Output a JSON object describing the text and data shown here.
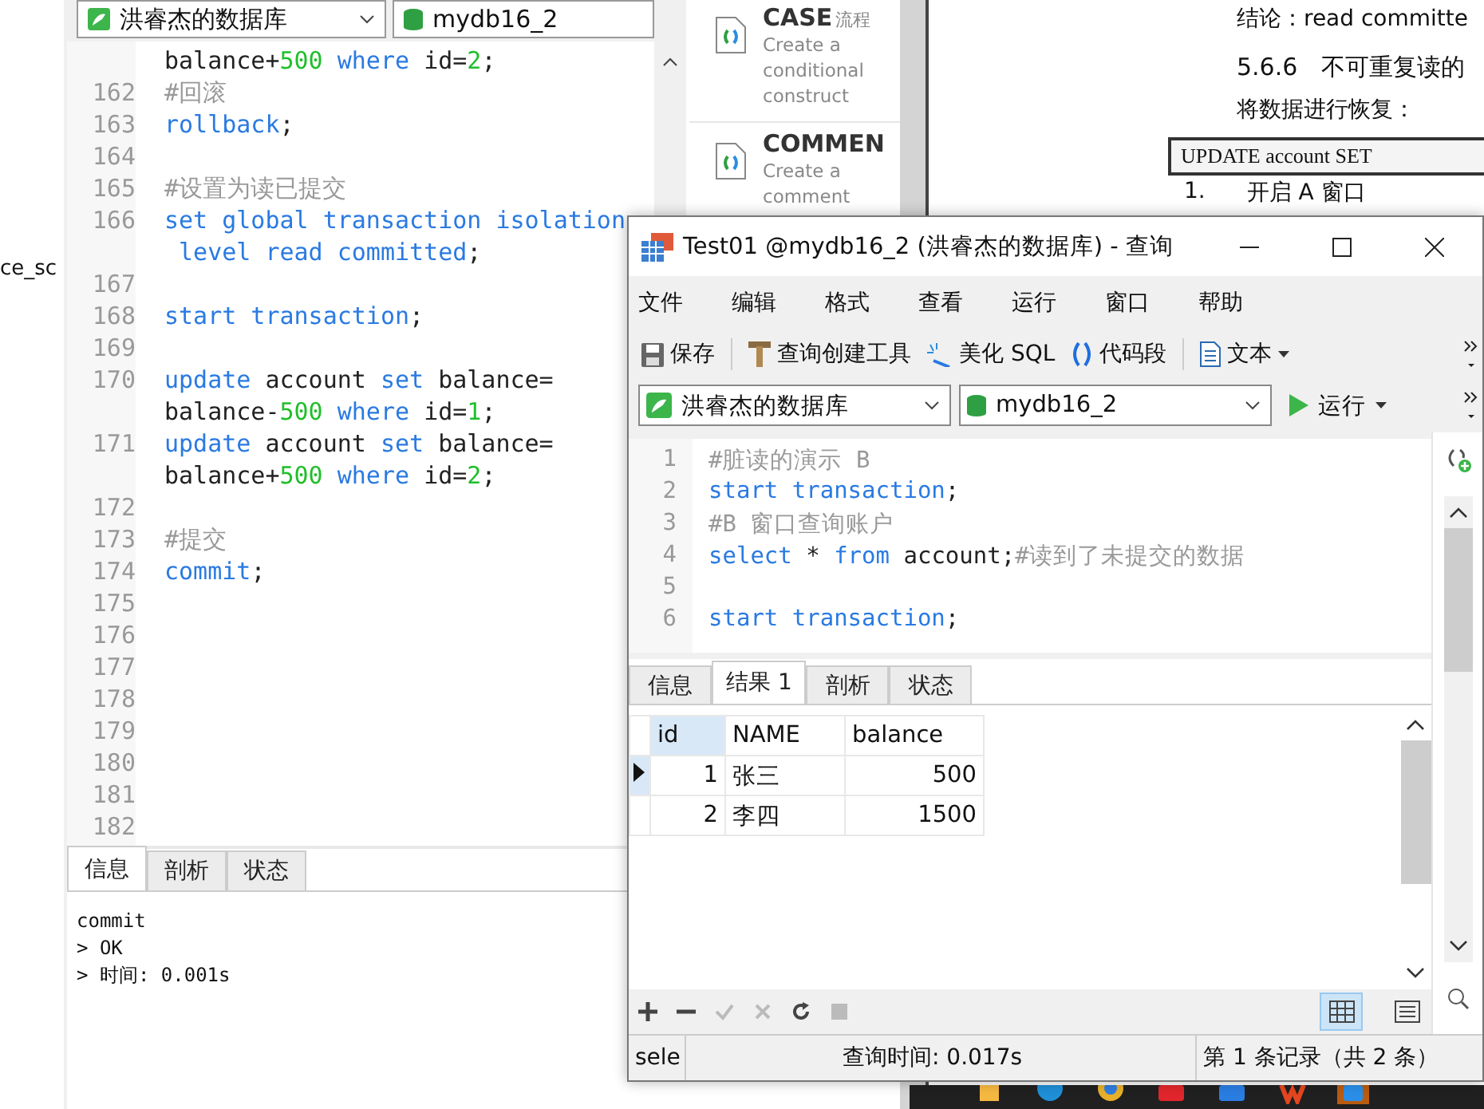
{
  "left_editor": {
    "connection": "洪睿杰的数据库",
    "database": "mydb16_2",
    "side_text": "ce_sc",
    "lines": [
      {
        "tokens": [
          {
            "kind": "plain",
            "text": "balance+"
          },
          {
            "kind": "num",
            "text": "500"
          },
          {
            "kind": "kw",
            "text": " where "
          },
          {
            "kind": "plain",
            "text": "id="
          },
          {
            "kind": "num",
            "text": "2"
          },
          {
            "kind": "plain",
            "text": ";"
          }
        ]
      },
      {
        "number": "162",
        "tokens": [
          {
            "kind": "comment",
            "text": "#回滚"
          }
        ]
      },
      {
        "number": "163",
        "tokens": [
          {
            "kind": "kw",
            "text": "rollback"
          },
          {
            "kind": "plain",
            "text": ";"
          }
        ]
      },
      {
        "number": "164"
      },
      {
        "number": "165",
        "tokens": [
          {
            "kind": "comment",
            "text": "#设置为读已提交"
          }
        ]
      },
      {
        "number": "166",
        "tokens": [
          {
            "kind": "kw",
            "text": "set global transaction isolation"
          }
        ]
      },
      {
        "tokens": [
          {
            "kind": "kw",
            "text": " level read committed"
          },
          {
            "kind": "plain",
            "text": ";"
          }
        ]
      },
      {
        "number": "167"
      },
      {
        "number": "168",
        "tokens": [
          {
            "kind": "kw",
            "text": "start transaction"
          },
          {
            "kind": "plain",
            "text": ";"
          }
        ]
      },
      {
        "number": "169"
      },
      {
        "number": "170",
        "tokens": [
          {
            "kind": "kw",
            "text": "update "
          },
          {
            "kind": "plain",
            "text": "account "
          },
          {
            "kind": "kw",
            "text": "set "
          },
          {
            "kind": "plain",
            "text": "balance="
          }
        ]
      },
      {
        "tokens": [
          {
            "kind": "plain",
            "text": "balance-"
          },
          {
            "kind": "num",
            "text": "500"
          },
          {
            "kind": "kw",
            "text": " where "
          },
          {
            "kind": "plain",
            "text": "id="
          },
          {
            "kind": "num",
            "text": "1"
          },
          {
            "kind": "plain",
            "text": ";"
          }
        ]
      },
      {
        "number": "171",
        "tokens": [
          {
            "kind": "kw",
            "text": "update "
          },
          {
            "kind": "plain",
            "text": "account "
          },
          {
            "kind": "kw",
            "text": "set "
          },
          {
            "kind": "plain",
            "text": "balance="
          }
        ]
      },
      {
        "tokens": [
          {
            "kind": "plain",
            "text": "balance+"
          },
          {
            "kind": "num",
            "text": "500"
          },
          {
            "kind": "kw",
            "text": " where "
          },
          {
            "kind": "plain",
            "text": "id="
          },
          {
            "kind": "num",
            "text": "2"
          },
          {
            "kind": "plain",
            "text": ";"
          }
        ]
      },
      {
        "number": "172"
      },
      {
        "number": "173",
        "tokens": [
          {
            "kind": "comment",
            "text": "#提交"
          }
        ]
      },
      {
        "number": "174",
        "tokens": [
          {
            "kind": "kw",
            "text": "commit"
          },
          {
            "kind": "plain",
            "text": ";"
          }
        ]
      },
      {
        "number": "175"
      },
      {
        "number": "176"
      },
      {
        "number": "177"
      },
      {
        "number": "178"
      },
      {
        "number": "179"
      },
      {
        "number": "180"
      },
      {
        "number": "181"
      },
      {
        "number": "182"
      }
    ],
    "tabs": [
      {
        "label": "信息",
        "selected": true
      },
      {
        "label": "剖析",
        "selected": false
      },
      {
        "label": "状态",
        "selected": false
      }
    ],
    "messages": [
      "commit",
      "> OK",
      "> 时间: 0.001s"
    ]
  },
  "snippets": [
    {
      "title": "CASE",
      "tag": "流程",
      "description": "Create a conditional construct"
    },
    {
      "title": "COMMEN",
      "description": "Create a comment"
    }
  ],
  "document": [
    {
      "kind": "text",
      "text": "结论：read committe"
    },
    {
      "kind": "heading",
      "text": "5.6.6　不可重复读的"
    },
    {
      "kind": "text",
      "text": "将数据进行恢复："
    },
    {
      "kind": "code",
      "text": "UPDATE account SET"
    },
    {
      "kind": "step",
      "number": "1.",
      "text": "开启 A 窗口"
    }
  ],
  "query_window": {
    "title": "Test01 @mydb16_2 (洪睿杰的数据库) - 查询",
    "menu": [
      "文件",
      "编辑",
      "格式",
      "查看",
      "运行",
      "窗口",
      "帮助"
    ],
    "toolbar": [
      [
        {
          "kind": "save",
          "label": "保存"
        }
      ],
      [
        {
          "kind": "builder",
          "label": "查询创建工具"
        },
        {
          "kind": "beautify",
          "label": "美化 SQL"
        },
        {
          "kind": "snippet",
          "label": "代码段"
        }
      ],
      [
        {
          "kind": "text",
          "label": "文本",
          "dropdown": true
        }
      ]
    ],
    "connection": "洪睿杰的数据库",
    "database": "mydb16_2",
    "run_label": "运行",
    "lines": [
      {
        "number": "1",
        "tokens": [
          {
            "kind": "comment",
            "text": "#脏读的演示 B"
          }
        ]
      },
      {
        "number": "2",
        "tokens": [
          {
            "kind": "kw",
            "text": "start transaction"
          },
          {
            "kind": "plain",
            "text": ";"
          }
        ]
      },
      {
        "number": "3",
        "tokens": [
          {
            "kind": "comment",
            "text": "#B 窗口查询账户"
          }
        ]
      },
      {
        "number": "4",
        "tokens": [
          {
            "kind": "kw",
            "text": "select "
          },
          {
            "kind": "plain",
            "text": "* "
          },
          {
            "kind": "kw",
            "text": "from "
          },
          {
            "kind": "plain",
            "text": "account;"
          },
          {
            "kind": "comment",
            "text": "#读到了未提交的数据"
          }
        ]
      },
      {
        "number": "5"
      },
      {
        "number": "6",
        "tokens": [
          {
            "kind": "kw",
            "text": "start transaction"
          },
          {
            "kind": "plain",
            "text": ";"
          }
        ]
      }
    ],
    "tabs": [
      {
        "label": "信息",
        "selected": false
      },
      {
        "label": "结果 1",
        "selected": true
      },
      {
        "label": "剖析",
        "selected": false
      },
      {
        "label": "状态",
        "selected": false
      }
    ],
    "columns": [
      "id",
      "NAME",
      "balance"
    ],
    "rows": [
      {
        "selected": true,
        "cells": [
          "1",
          "张三",
          "500"
        ]
      },
      {
        "selected": false,
        "cells": [
          "2",
          "李四",
          "1500"
        ]
      }
    ],
    "view_modes": [
      {
        "kind": "grid",
        "selected": true
      },
      {
        "kind": "form",
        "selected": false
      }
    ],
    "status": [
      "sele",
      "查询时间: 0.017s",
      "第 1 条记录（共 2 条）"
    ]
  }
}
